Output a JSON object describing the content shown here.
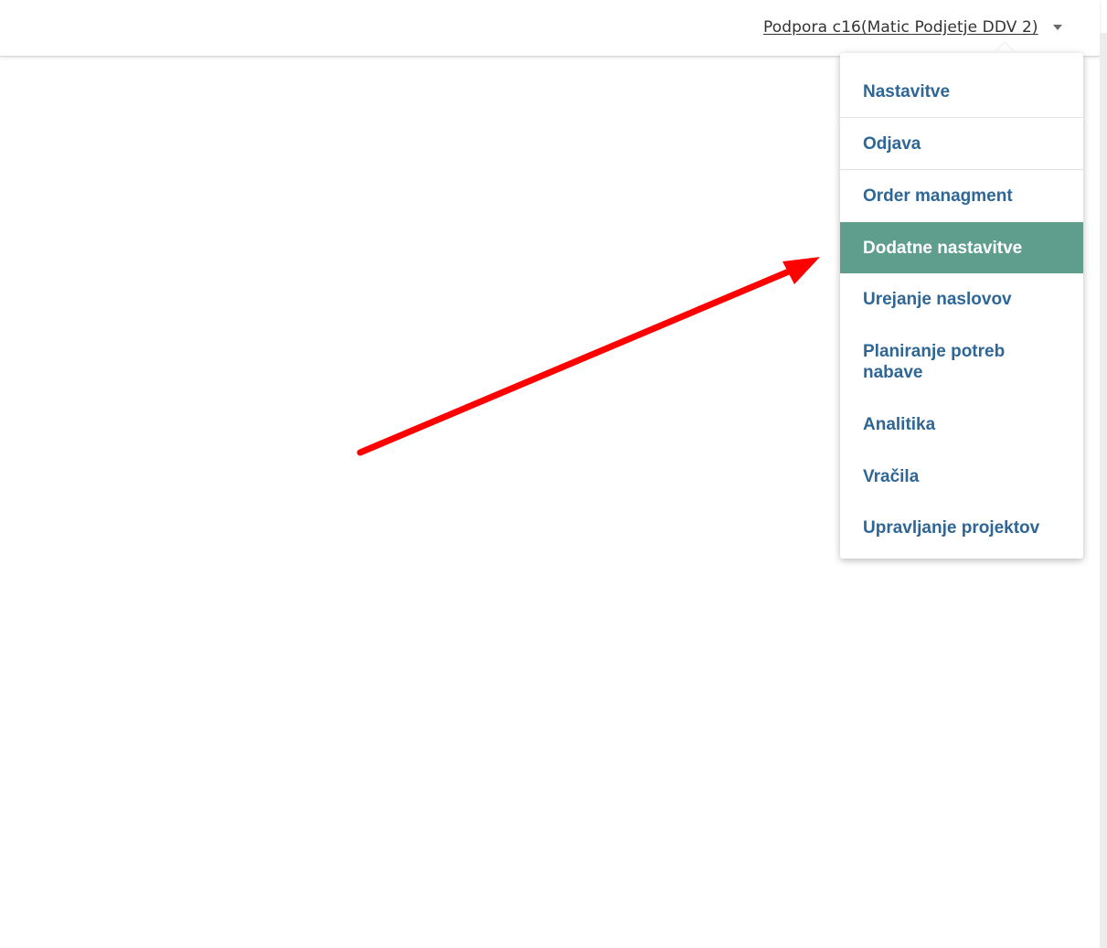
{
  "header": {
    "user_label": "Podpora c16(Matic Podjetje DDV 2)"
  },
  "user_menu": {
    "items": [
      {
        "label": "Nastavitve"
      },
      {
        "label": "Odjava"
      },
      {
        "label": "Order managment"
      },
      {
        "label": "Dodatne nastavitve",
        "active": true
      },
      {
        "label": "Urejanje naslovov"
      },
      {
        "label": "Planiranje potreb nabave"
      },
      {
        "label": "Analitika"
      },
      {
        "label": "Vračila"
      },
      {
        "label": "Upravljanje projektov"
      }
    ]
  },
  "colors": {
    "menu_text": "#2e6696",
    "active_bg": "#5f9e8c",
    "annotation_arrow": "#ff0000"
  },
  "icons": {
    "caret": "caret-down-icon",
    "annotation": "red-arrow-annotation"
  }
}
